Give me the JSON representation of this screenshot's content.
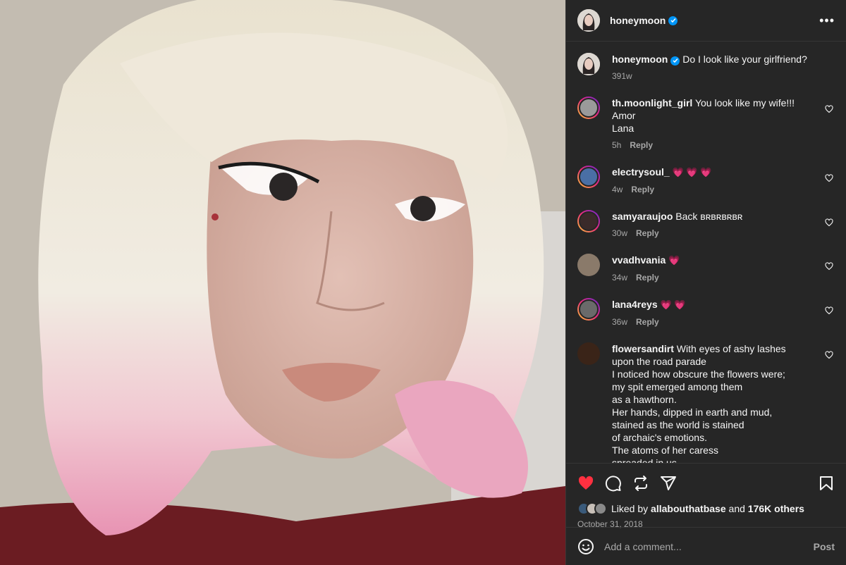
{
  "post": {
    "username": "honeymoon",
    "verified": true,
    "caption": "Do I look like your girlfriend?",
    "caption_age": "391w",
    "likes_user": "allabouthatbase",
    "likes_text": "Liked by",
    "likes_and": "and",
    "likes_others": "176K others",
    "date": "October 31, 2018"
  },
  "comments": [
    {
      "username": "th.moonlight_girl",
      "text": "You look like my wife!!! Amor\nLana",
      "age": "5h",
      "reply": "Reply",
      "avatar_color": "#9a9a9a",
      "ring": true
    },
    {
      "username": "electrysoul_",
      "text": "💗 💗 💗",
      "age": "4w",
      "reply": "Reply",
      "avatar_color": "#4a6fa5",
      "ring": true
    },
    {
      "username": "samyaraujoo",
      "text": "Back ʙʀʙʀʙʀʙʀ",
      "age": "30w",
      "reply": "Reply",
      "avatar_color": "#3a2a2a",
      "ring": true
    },
    {
      "username": "vvadhvania",
      "text": "💗",
      "age": "34w",
      "reply": "Reply",
      "avatar_color": "#8a7a6a",
      "ring": false
    },
    {
      "username": "lana4reys",
      "text": "💗 💗",
      "age": "36w",
      "reply": "Reply",
      "avatar_color": "#6a6a6a",
      "ring": true
    },
    {
      "username": "flowersandirt",
      "text": "With eyes of ashy lashes\nupon the road parade\nI noticed how obscure the flowers were;\nmy spit emerged among them\nas a hawthorn.\nHer hands, dipped in earth and mud,\nstained as the world is stained\nof archaic's emotions.\nThe atoms of her caress\nspreaded in us",
      "age": "",
      "reply": "",
      "avatar_color": "#3a2418",
      "ring": false
    }
  ],
  "ui": {
    "more_label": "•••",
    "add_comment_placeholder": "Add a comment...",
    "post_label": "Post"
  },
  "icons": [
    "like-heart-icon",
    "comment-icon",
    "repost-icon",
    "share-icon",
    "bookmark-icon",
    "emoji-icon",
    "verified-icon",
    "more-icon"
  ],
  "colors": {
    "like_red": "#ff3040",
    "verified_blue": "#0095f6",
    "panel_bg": "#262626"
  }
}
